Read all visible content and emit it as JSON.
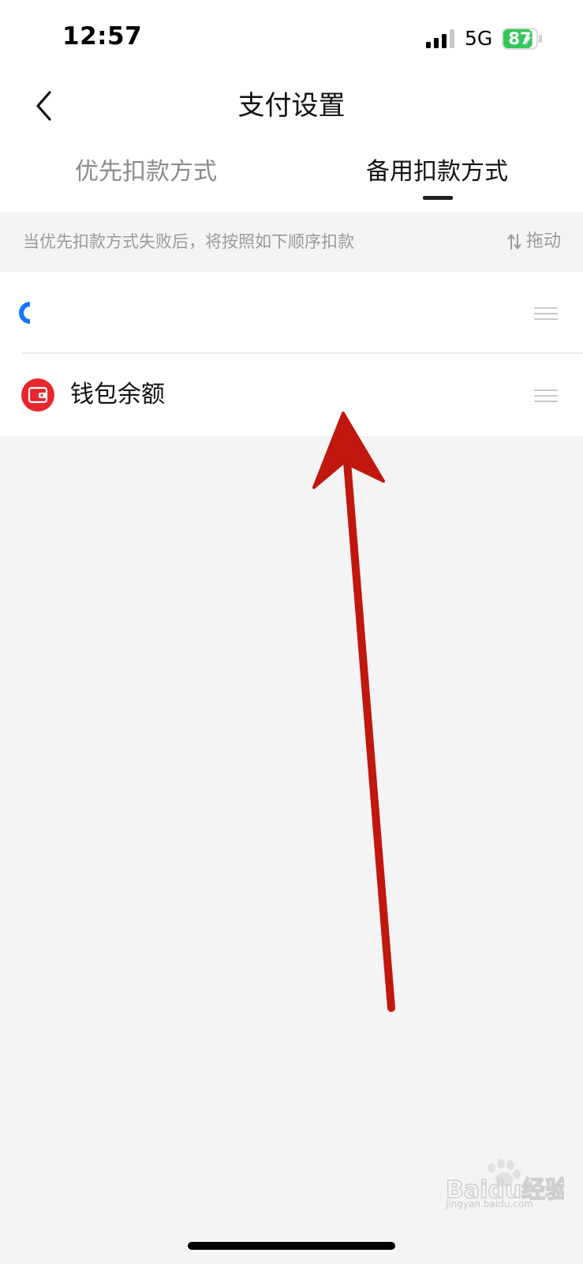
{
  "status_bar": {
    "time": "12:57",
    "network": "5G",
    "battery_level": "87",
    "battery_fraction": 0.87,
    "battery_color": "#34c759"
  },
  "header": {
    "title": "支付设置",
    "back_icon": "chevron-left-icon"
  },
  "tabs": [
    {
      "label": "优先扣款方式",
      "active": false
    },
    {
      "label": "备用扣款方式",
      "active": true
    }
  ],
  "hint": {
    "text": "当优先扣款方式失败后，将按照如下顺序扣款",
    "drag_label": "拖动",
    "drag_icon": "sort-arrows-icon"
  },
  "payment_methods": [
    {
      "label": "",
      "icon": "bank-card-icon",
      "icon_color": "#1677ff"
    },
    {
      "label": "钱包余额",
      "icon": "wallet-icon",
      "icon_color": "#e8262b"
    }
  ],
  "annotation": {
    "color": "#c0170f"
  },
  "watermark": {
    "text": "Baidu经验",
    "subtext": "jingyan.baidu.com"
  }
}
